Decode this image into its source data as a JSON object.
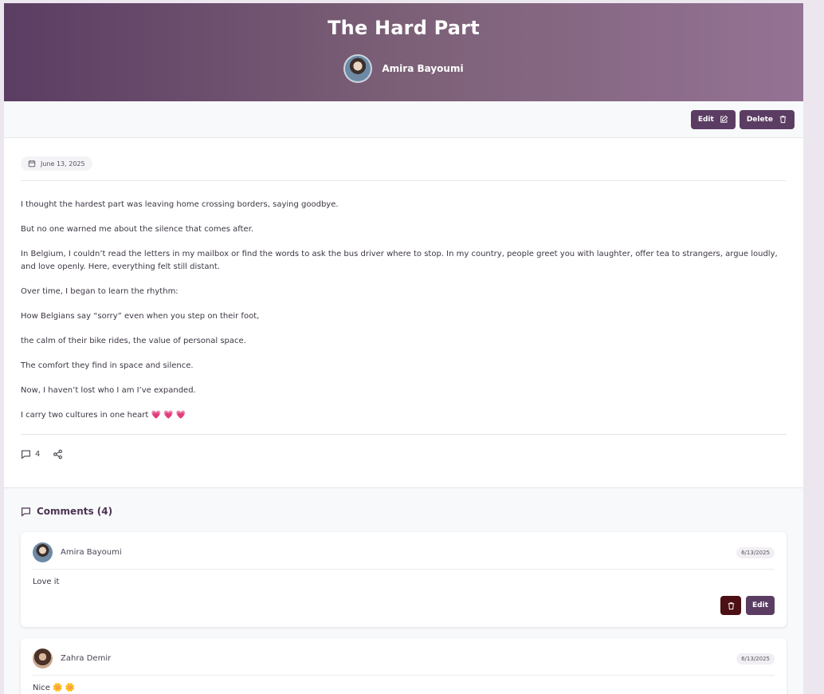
{
  "post": {
    "title": "The Hard Part",
    "author": "Amira Bayoumi",
    "date": "June 13, 2025",
    "paragraphs": [
      "I thought the hardest part was leaving home crossing borders, saying goodbye.",
      "But no one warned me about the silence that comes after.",
      "In Belgium, I couldn’t read the letters in my mailbox or find the words to ask the bus driver where to stop. In my country, people greet you with laughter, offer tea to strangers, argue loudly, and love openly. Here, everything felt still distant.",
      "Over time, I began to learn the rhythm:",
      "How Belgians say “sorry” even when you step on their foot,",
      "the calm of their bike rides, the value of personal space.",
      "The comfort they find in space and silence.",
      "Now, I haven’t lost who I am I’ve expanded.",
      "I carry two cultures in one heart 💗 💗 💗"
    ],
    "comment_count": "4"
  },
  "toolbar": {
    "edit_label": "Edit",
    "delete_label": "Delete"
  },
  "comments": {
    "title": "Comments (4)",
    "items": [
      {
        "user": "Amira Bayoumi",
        "date": "6/13/2025",
        "text": "Love it",
        "edit_label": "Edit"
      },
      {
        "user": "Zahra Demir",
        "date": "6/13/2025",
        "text": "Nice 🌼 🌼"
      }
    ]
  },
  "colors": {
    "accent": "#5b3d63",
    "danger": "#4b0f14",
    "hero_start": "#5b3d63",
    "hero_end": "#947294"
  },
  "icons": {
    "edit": "pencil-square-icon",
    "delete": "trash-icon",
    "date": "calendar-icon",
    "comments": "speech-bubble-icon",
    "share": "share-icon"
  }
}
